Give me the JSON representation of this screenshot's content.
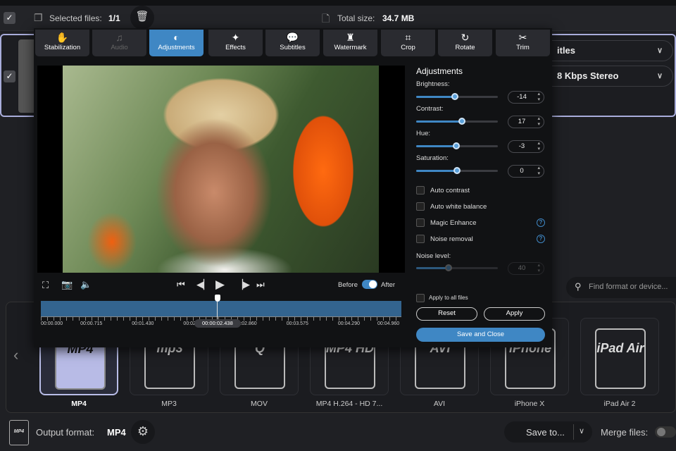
{
  "topbar": {
    "selected_label": "Selected files:",
    "selected_value": "1/1",
    "total_label": "Total size:",
    "total_value": "34.7 MB"
  },
  "file_row": {
    "subtitles_dropdown": "itles",
    "audio_dropdown": "8 Kbps Stereo"
  },
  "tabs": [
    {
      "label": "Stabilization",
      "icon": "✋"
    },
    {
      "label": "Audio",
      "icon": "♫"
    },
    {
      "label": "Adjustments",
      "icon": "◐"
    },
    {
      "label": "Effects",
      "icon": "✦"
    },
    {
      "label": "Subtitles",
      "icon": "💬"
    },
    {
      "label": "Watermark",
      "icon": "♜"
    },
    {
      "label": "Crop",
      "icon": "⌗"
    },
    {
      "label": "Rotate",
      "icon": "↻"
    },
    {
      "label": "Trim",
      "icon": "✂"
    }
  ],
  "adjustments": {
    "title": "Adjustments",
    "sliders": [
      {
        "label": "Brightness:",
        "value": "-14",
        "fraction": 0.47
      },
      {
        "label": "Contrast:",
        "value": "17",
        "fraction": 0.56
      },
      {
        "label": "Hue:",
        "value": "-3",
        "fraction": 0.49
      },
      {
        "label": "Saturation:",
        "value": "0",
        "fraction": 0.5
      }
    ],
    "checkboxes": [
      {
        "label": "Auto contrast",
        "checked": false
      },
      {
        "label": "Auto white balance",
        "checked": false
      },
      {
        "label": "Magic Enhance",
        "checked": false
      },
      {
        "label": "Noise removal",
        "checked": false
      }
    ],
    "noise_label": "Noise level:",
    "noise_value": "40",
    "noise_fraction": 0.4,
    "apply_all": "Apply to all files",
    "reset": "Reset",
    "apply": "Apply",
    "save_close": "Save and Close"
  },
  "player": {
    "before": "Before",
    "after": "After",
    "current_time": "00:00:02.438",
    "position": 0.49,
    "ticks": [
      "00:00.000",
      "00:00.715",
      "00:01.430",
      "00:02.145",
      "00:02.860",
      "00:03.575",
      "00:04.290",
      "00:04.960"
    ]
  },
  "search": {
    "placeholder": "Find format or device..."
  },
  "formats": [
    {
      "label": "MP4",
      "icon": "MP4"
    },
    {
      "label": "MP3",
      "icon": "mp3"
    },
    {
      "label": "MOV",
      "icon": "Q"
    },
    {
      "label": "MP4 H.264 - HD 7...",
      "icon": "MP4 HD"
    },
    {
      "label": "AVI",
      "icon": "AVI"
    },
    {
      "label": "iPhone X",
      "icon": "iPhone"
    },
    {
      "label": "iPad Air 2",
      "icon": "iPad Air"
    }
  ],
  "bottom": {
    "output_label": "Output format:",
    "output_value": "MP4",
    "save_to": "Save to...",
    "merge": "Merge files:"
  },
  "colors": {
    "accent": "#3f87c4",
    "timeline": "#33648f",
    "selected_border": "#a9addb"
  }
}
